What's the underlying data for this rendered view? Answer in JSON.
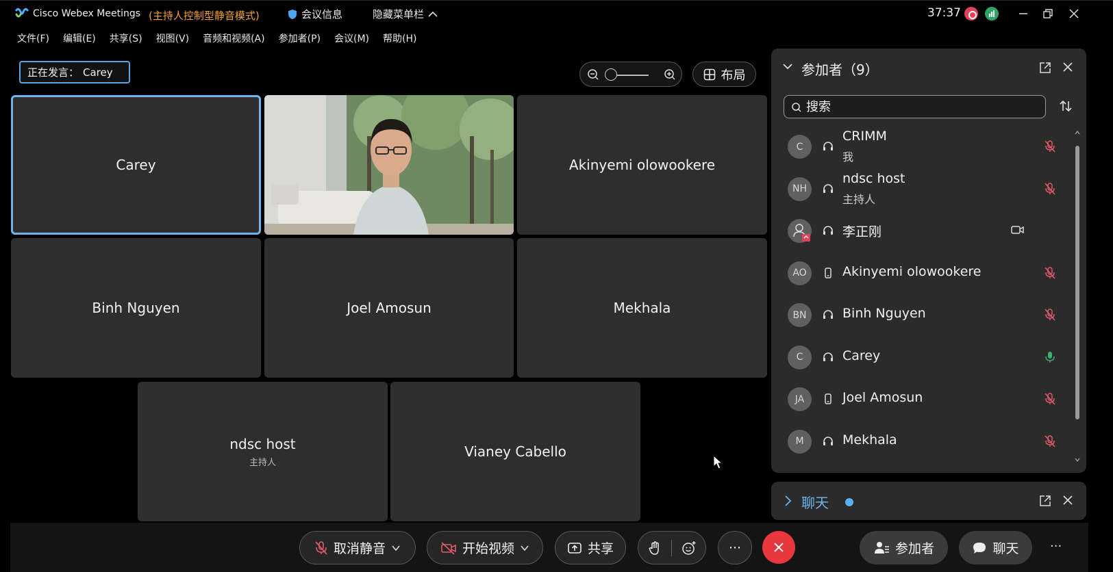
{
  "titlebar": {
    "app_name": "Cisco Webex Meetings",
    "mode": "(主持人控制型静音模式)",
    "meeting_info": "会议信息",
    "hide_menu": "隐藏菜单栏",
    "timer": "37:37",
    "colors": {
      "mode": "#f2a030",
      "record": "#e0425c",
      "signal": "#2fa56a"
    }
  },
  "menu": [
    {
      "label": "文件(F)"
    },
    {
      "label": "编辑(E)"
    },
    {
      "label": "共享(S)"
    },
    {
      "label": "视图(V)"
    },
    {
      "label": "音频和视频(A)"
    },
    {
      "label": "参加者(P)"
    },
    {
      "label": "会议(M)"
    },
    {
      "label": "帮助(H)"
    }
  ],
  "speaker": {
    "label": "正在发言：",
    "name": "Carey"
  },
  "layout_button": "布局",
  "tiles": [
    {
      "name": "Carey",
      "active": true
    },
    {
      "name": "",
      "video": true
    },
    {
      "name": "Akinyemi olowookere"
    },
    {
      "name": "Binh Nguyen"
    },
    {
      "name": "Joel Amosun"
    },
    {
      "name": "Mekhala"
    },
    {
      "name": "ndsc host",
      "role": "主持人"
    },
    {
      "name": "Vianey Cabello"
    }
  ],
  "participants_panel": {
    "title": "参加者（9）",
    "search_placeholder": "搜索",
    "participants": [
      {
        "initials": "C",
        "name": "CRIMM",
        "sub": "我",
        "device": "headset-icon",
        "status": "mic-muted-icon"
      },
      {
        "initials": "NH",
        "name": "ndsc host",
        "sub": "主持人",
        "device": "headset-icon",
        "status": "mic-muted-icon"
      },
      {
        "initials": "",
        "name": "李正刚",
        "sub": "",
        "device": "headset-icon",
        "status": "camera-icon"
      },
      {
        "initials": "AO",
        "name": "Akinyemi olowookere",
        "sub": "",
        "device": "phone-icon",
        "status": "mic-muted-icon"
      },
      {
        "initials": "BN",
        "name": "Binh Nguyen",
        "sub": "",
        "device": "headset-icon",
        "status": "mic-muted-icon"
      },
      {
        "initials": "C",
        "name": "Carey",
        "sub": "",
        "device": "headset-icon",
        "status": "mic-active-icon"
      },
      {
        "initials": "JA",
        "name": "Joel Amosun",
        "sub": "",
        "device": "phone-icon",
        "status": "mic-muted-icon"
      },
      {
        "initials": "M",
        "name": "Mekhala",
        "sub": "",
        "device": "headset-icon",
        "status": "mic-muted-icon"
      }
    ]
  },
  "chat_panel": {
    "title": "聊天"
  },
  "toolbar": {
    "unmute": "取消静音",
    "start_video": "开始视频",
    "share": "共享",
    "more": "···",
    "participants": "参加者",
    "chat": "聊天",
    "overflow": "···",
    "colors": {
      "leave": "#e8383e"
    }
  }
}
